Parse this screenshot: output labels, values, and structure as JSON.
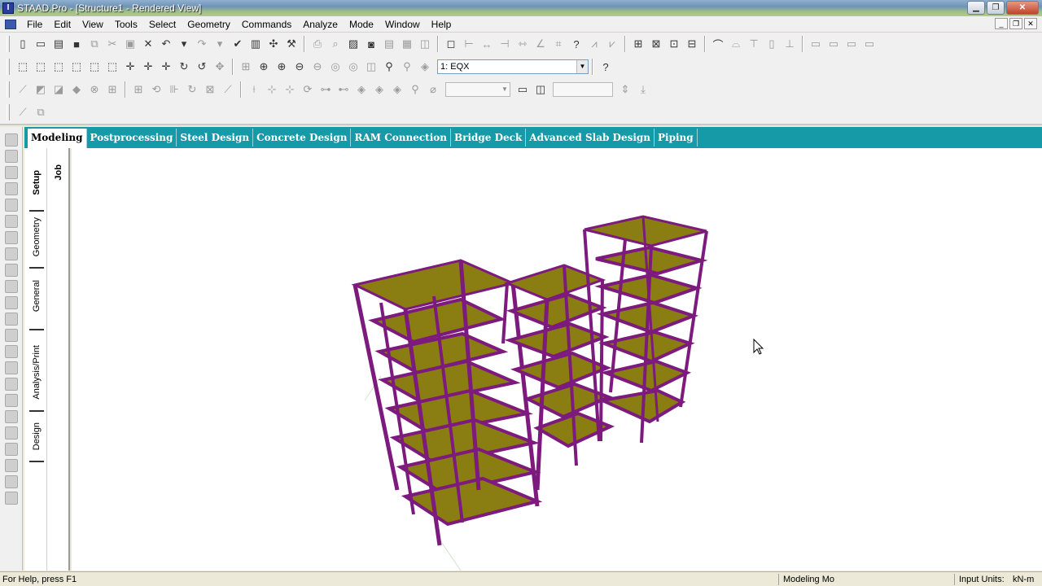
{
  "window": {
    "title": "STAAD.Pro - [Structure1 - Rendered View]",
    "app_icon": "staad-logo-icon"
  },
  "menu": {
    "items": [
      "File",
      "Edit",
      "View",
      "Tools",
      "Select",
      "Geometry",
      "Commands",
      "Analyze",
      "Mode",
      "Window",
      "Help"
    ]
  },
  "toolbar2": {
    "load_case": "1: EQX"
  },
  "page_tabs": {
    "items": [
      "Modeling",
      "Postprocessing",
      "Steel Design",
      "Concrete Design",
      "RAM Connection",
      "Bridge Deck",
      "Advanced Slab Design",
      "Piping"
    ],
    "active": "Modeling"
  },
  "vertical_tabs": {
    "setup": "Setup",
    "geometry": "Geometry",
    "general": "General",
    "analysis_print": "Analysis/Print",
    "design": "Design",
    "job": "Job"
  },
  "statusbar": {
    "help": "For Help, press F1",
    "mode": "Modeling Mo",
    "units_label": "Input Units:",
    "units_value": "kN-m"
  },
  "colors": {
    "tab_strip": "#169aa8",
    "frame": "#7d1a7d",
    "slab": "#8a7d12"
  }
}
